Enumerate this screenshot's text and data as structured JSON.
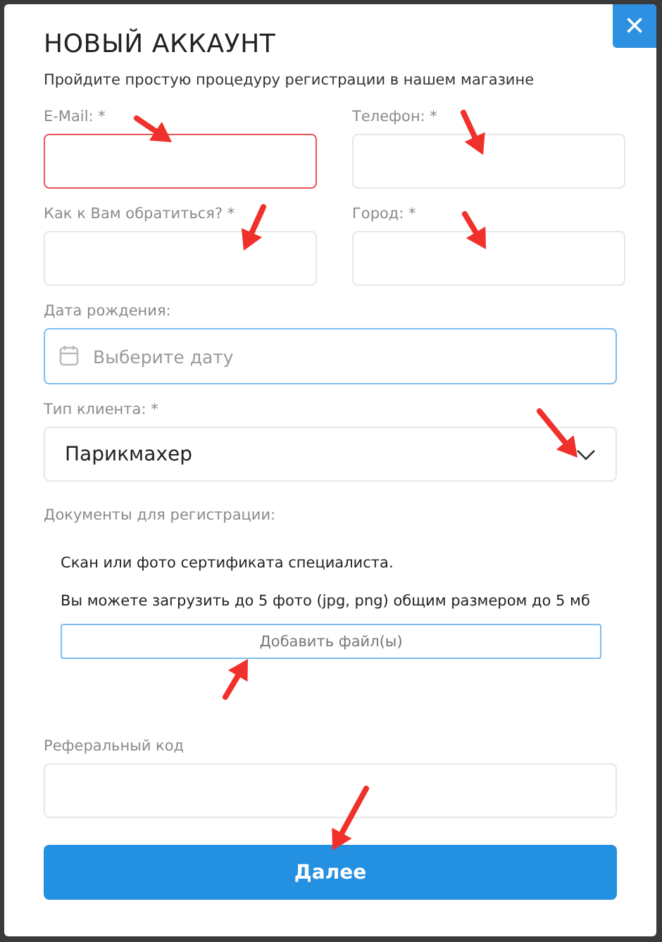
{
  "dialog": {
    "title": "НОВЫЙ АККАУНТ",
    "subtitle": "Пройдите простую процедуру регистрации в нашем магазине",
    "close": "×"
  },
  "fields": [
    {
      "kind": "text",
      "label": "E-Mail: *",
      "error": true
    },
    {
      "kind": "text",
      "label": "Телефон: *",
      "error": false
    },
    {
      "kind": "text",
      "label": "Как к Вам обратиться? *",
      "error": false
    },
    {
      "kind": "text",
      "label": "Город: *",
      "error": false
    }
  ],
  "birth_date": {
    "label": "Дата рождения:",
    "placeholder": "Выберите дату",
    "focused": true
  },
  "client_type": {
    "label": "Тип клиента: *",
    "value": "Парикмахер"
  },
  "documents": {
    "label": "Документы для регистрации:",
    "note": "Скан или фото сертификата специалиста.",
    "limits": "Вы можете загрузить до 5 фото (jpg, png) общим размером до 5 мб",
    "button": "Добавить файл(ы)"
  },
  "referral": {
    "label": "Реферальный код"
  },
  "submit": "Далее"
}
